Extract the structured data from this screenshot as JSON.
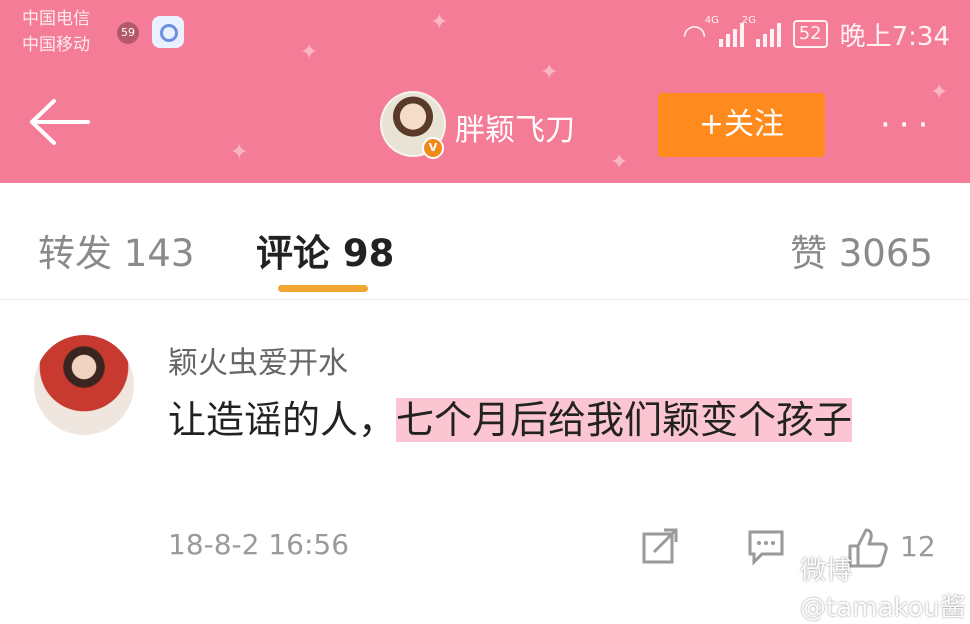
{
  "status": {
    "carrier1": "中国电信",
    "carrier2": "中国移动",
    "notif_count": "59",
    "sig1_label": "4G",
    "sig2_label": "2G",
    "battery": "52",
    "time": "晚上7:34"
  },
  "nav": {
    "username": "胖颖飞刀",
    "verified_label": "V",
    "follow_label": "+关注",
    "more": "···"
  },
  "tabs": [
    {
      "label": "转发 143"
    },
    {
      "label": "评论 98"
    },
    {
      "label": "赞 3065"
    }
  ],
  "comment": {
    "author": "颖火虫爱开水",
    "text_plain": "让造谣的人，",
    "text_highlight": "七个月后给我们颖变个孩子",
    "time": "18-8-2 16:56",
    "likes": "12"
  },
  "watermark": "微博 @tamakou酱",
  "colors": {
    "header_bg": "#f57c97",
    "follow_bg": "#ff8a1d",
    "tab_indicator": "#f3a532",
    "highlight": "#f8a0b2"
  }
}
